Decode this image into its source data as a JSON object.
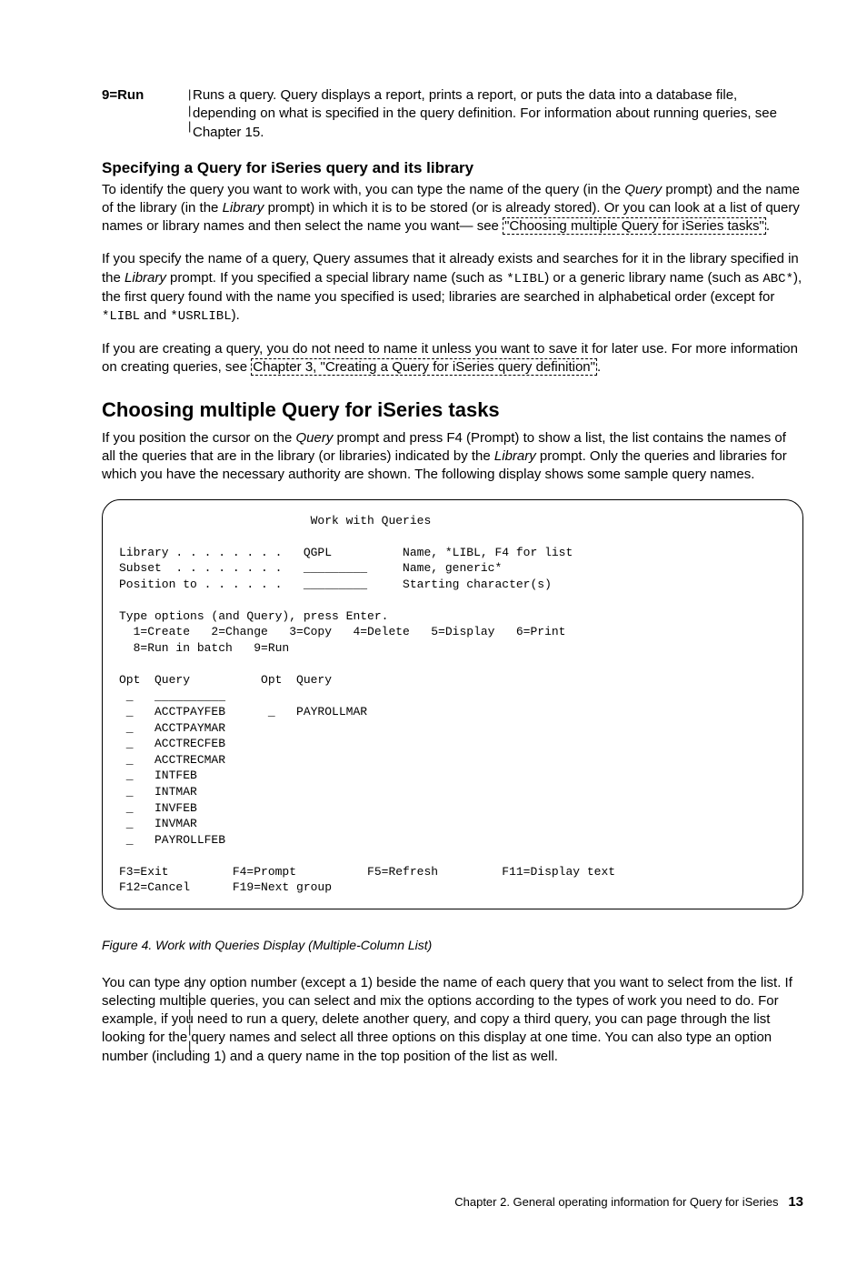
{
  "def": {
    "term": "9=Run",
    "desc_parts": [
      "Runs a query. Query displays a report, prints a report, or puts the data into a database file, depending on what is specified in the query definition. For information about running queries, see Chapter 15."
    ]
  },
  "bars": [
    "|",
    "|",
    "|"
  ],
  "sec1": {
    "heading": "Specifying a Query for iSeries query and its library",
    "p1a": "To identify the query you want to work with, you can type the name of the query (in the ",
    "p1b": " prompt) and the name of the library (in the ",
    "p1c": " prompt) in which it is to be stored (or is already stored). Or you can look at a list of query names or library names and then select the name you want— see ",
    "link1": "\"Choosing multiple Query for iSeries tasks\"",
    "p1d": ".",
    "query_word": "Query",
    "library_word": "Library",
    "p2a": "If you specify the name of a query, Query assumes that it already exists and searches for it in the library specified in the ",
    "p2b": " prompt. If you specified a special library name (such as ",
    "star_libl": "*LIBL",
    "p2c": ") or a generic library name (such as ",
    "abc_star": "ABC*",
    "p2d": "), the first query found with the name you specified is used; libraries are searched in alphabetical order (except for ",
    "p2e": " and ",
    "star_usrlibl": "*USRLIBL",
    "p2f": ").",
    "p3a": "If you are creating a query, you do not need to name it unless you want to save it for later use. For more information on creating queries, see ",
    "link2": "Chapter 3, \"Creating a Query for iSeries query definition\"",
    "p3b": "."
  },
  "sec2": {
    "heading": "Choosing multiple Query for iSeries tasks",
    "p1a": "If you position the cursor on the ",
    "p1b": " prompt and press F4 (Prompt) to show a list, the list contains the names of all the queries that are in the library (or libraries) indicated by the ",
    "p1c": " prompt. Only the queries and libraries for which you have the necessary authority are shown. The following display shows some sample query names.",
    "query_word": "Query",
    "library_word": "Library"
  },
  "terminal": {
    "title": "Work with Queries",
    "library_label": "Library . . . . . . . .",
    "library_value": "QGPL",
    "library_hint": "Name, *LIBL, F4 for list",
    "subset_label": "Subset  . . . . . . . .",
    "subset_hint": "Name, generic*",
    "position_label": "Position to . . . . . .",
    "position_hint": "Starting character(s)",
    "instr1": "Type options (and Query), press Enter.",
    "instr2": "  1=Create   2=Change   3=Copy   4=Delete   5=Display   6=Print",
    "instr3": "  8=Run in batch   9=Run",
    "colhead": "Opt  Query          Opt  Query",
    "rows": [
      " _   __________",
      " _   ACCTPAYFEB      _   PAYROLLMAR",
      " _   ACCTPAYMAR",
      " _   ACCTRECFEB",
      " _   ACCTRECMAR",
      " _   INTFEB",
      " _   INTMAR",
      " _   INVFEB",
      " _   INVMAR",
      " _   PAYROLLFEB"
    ],
    "fkeys1": "F3=Exit         F4=Prompt          F5=Refresh         F11=Display text",
    "fkeys2": "F12=Cancel      F19=Next group"
  },
  "figcaption": "Figure 4. Work with Queries Display (Multiple-Column List)",
  "bars2": [
    "|",
    "|",
    "|",
    "|",
    "|"
  ],
  "p_after": "You can type any option number (except a 1) beside the name of each query that you want to select from the list. If selecting multiple queries, you can select and mix the options according to the types of work you need to do. For example, if you need to run a query, delete another query, and copy a third query, you can page through the list looking for the query names and select all three options on this display at one time. You can also type an option number (including 1) and a query name in the top position of the list as well.",
  "footer": {
    "chapter": "Chapter 2. General operating information for Query for iSeries",
    "page": "13"
  }
}
